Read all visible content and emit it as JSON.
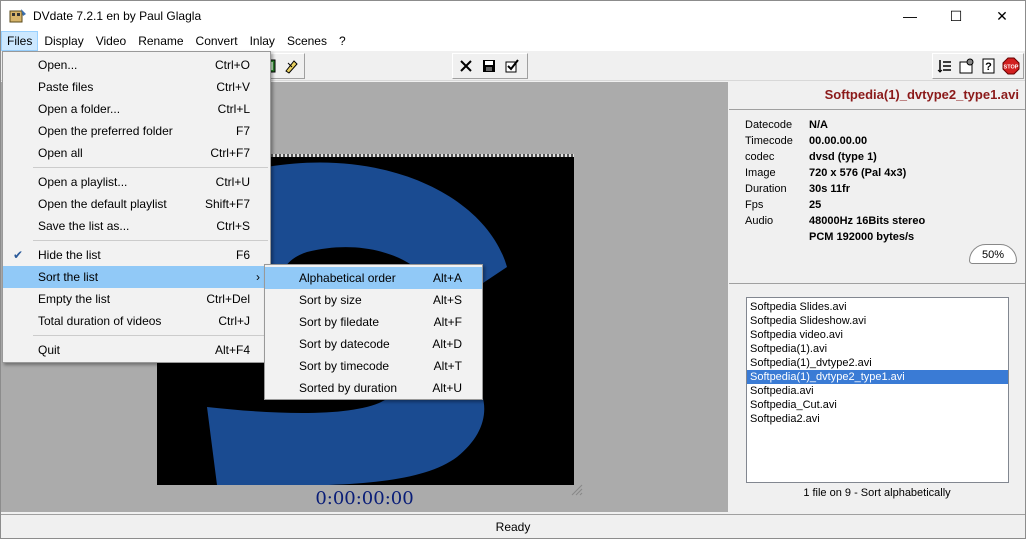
{
  "window": {
    "title": "DVdate 7.2.1 en by Paul Glagla",
    "minimize_glyph": "—",
    "maximize_glyph": "☐",
    "close_glyph": "✕"
  },
  "menubar": [
    "Files",
    "Display",
    "Video",
    "Rename",
    "Convert",
    "Inlay",
    "Scenes",
    "?"
  ],
  "files_menu": {
    "groups": [
      [
        {
          "label": "Open...",
          "shortcut": "Ctrl+O"
        },
        {
          "label": "Paste files",
          "shortcut": "Ctrl+V"
        },
        {
          "label": "Open a folder...",
          "shortcut": "Ctrl+L"
        },
        {
          "label": "Open the preferred folder",
          "shortcut": "F7"
        },
        {
          "label": "Open all",
          "shortcut": "Ctrl+F7"
        }
      ],
      [
        {
          "label": "Open a playlist...",
          "shortcut": "Ctrl+U"
        },
        {
          "label": "Open the default playlist",
          "shortcut": "Shift+F7"
        },
        {
          "label": "Save the list as...",
          "shortcut": "Ctrl+S"
        }
      ],
      [
        {
          "label": "Hide the list",
          "shortcut": "F6",
          "checked": true
        },
        {
          "label": "Sort the list",
          "shortcut": "",
          "submenu": true,
          "highlighted": true
        },
        {
          "label": "Empty the list",
          "shortcut": "Ctrl+Del"
        },
        {
          "label": "Total duration of videos",
          "shortcut": "Ctrl+J"
        }
      ],
      [
        {
          "label": "Quit",
          "shortcut": "Alt+F4"
        }
      ]
    ]
  },
  "sort_menu": [
    {
      "label": "Alphabetical order",
      "shortcut": "Alt+A",
      "highlighted": true
    },
    {
      "label": "Sort by size",
      "shortcut": "Alt+S"
    },
    {
      "label": "Sort by filedate",
      "shortcut": "Alt+F"
    },
    {
      "label": "Sort by datecode",
      "shortcut": "Alt+D"
    },
    {
      "label": "Sort by timecode",
      "shortcut": "Alt+T"
    },
    {
      "label": "Sorted by duration",
      "shortcut": "Alt+U"
    }
  ],
  "player": {
    "timecode": "0:00:00:00"
  },
  "file_info": {
    "title": "Softpedia(1)_dvtype2_type1.avi",
    "rows": [
      {
        "key": "Datecode",
        "value": "N/A"
      },
      {
        "key": "Timecode",
        "value": "00.00.00.00"
      },
      {
        "key": "codec",
        "value": "dvsd (type 1)"
      },
      {
        "key": "Image",
        "value": "720 x 576 (Pal 4x3)"
      },
      {
        "key": "Duration",
        "value": "30s 11fr"
      },
      {
        "key": "Fps",
        "value": "25"
      },
      {
        "key": "Audio",
        "value": "48000Hz 16Bits stereo"
      },
      {
        "key": "",
        "value": "PCM 192000 bytes/s"
      }
    ],
    "zoom": "50%"
  },
  "file_list": {
    "items": [
      "Softpedia Slides.avi",
      "Softpedia Slideshow.avi",
      "Softpedia video.avi",
      "Softpedia(1).avi",
      "Softpedia(1)_dvtype2.avi",
      "Softpedia(1)_dvtype2_type1.avi",
      "Softpedia.avi",
      "Softpedia_Cut.avi",
      "Softpedia2.avi"
    ],
    "selected_index": 5,
    "status": "1 file on 9 - Sort alphabetically"
  },
  "statusbar": {
    "text": "Ready"
  },
  "colors": {
    "file_title": "#8b1a1a",
    "timecode": "#0a1e78",
    "menu_highlight": "#91c9f7",
    "list_selection": "#3a7bd5"
  }
}
